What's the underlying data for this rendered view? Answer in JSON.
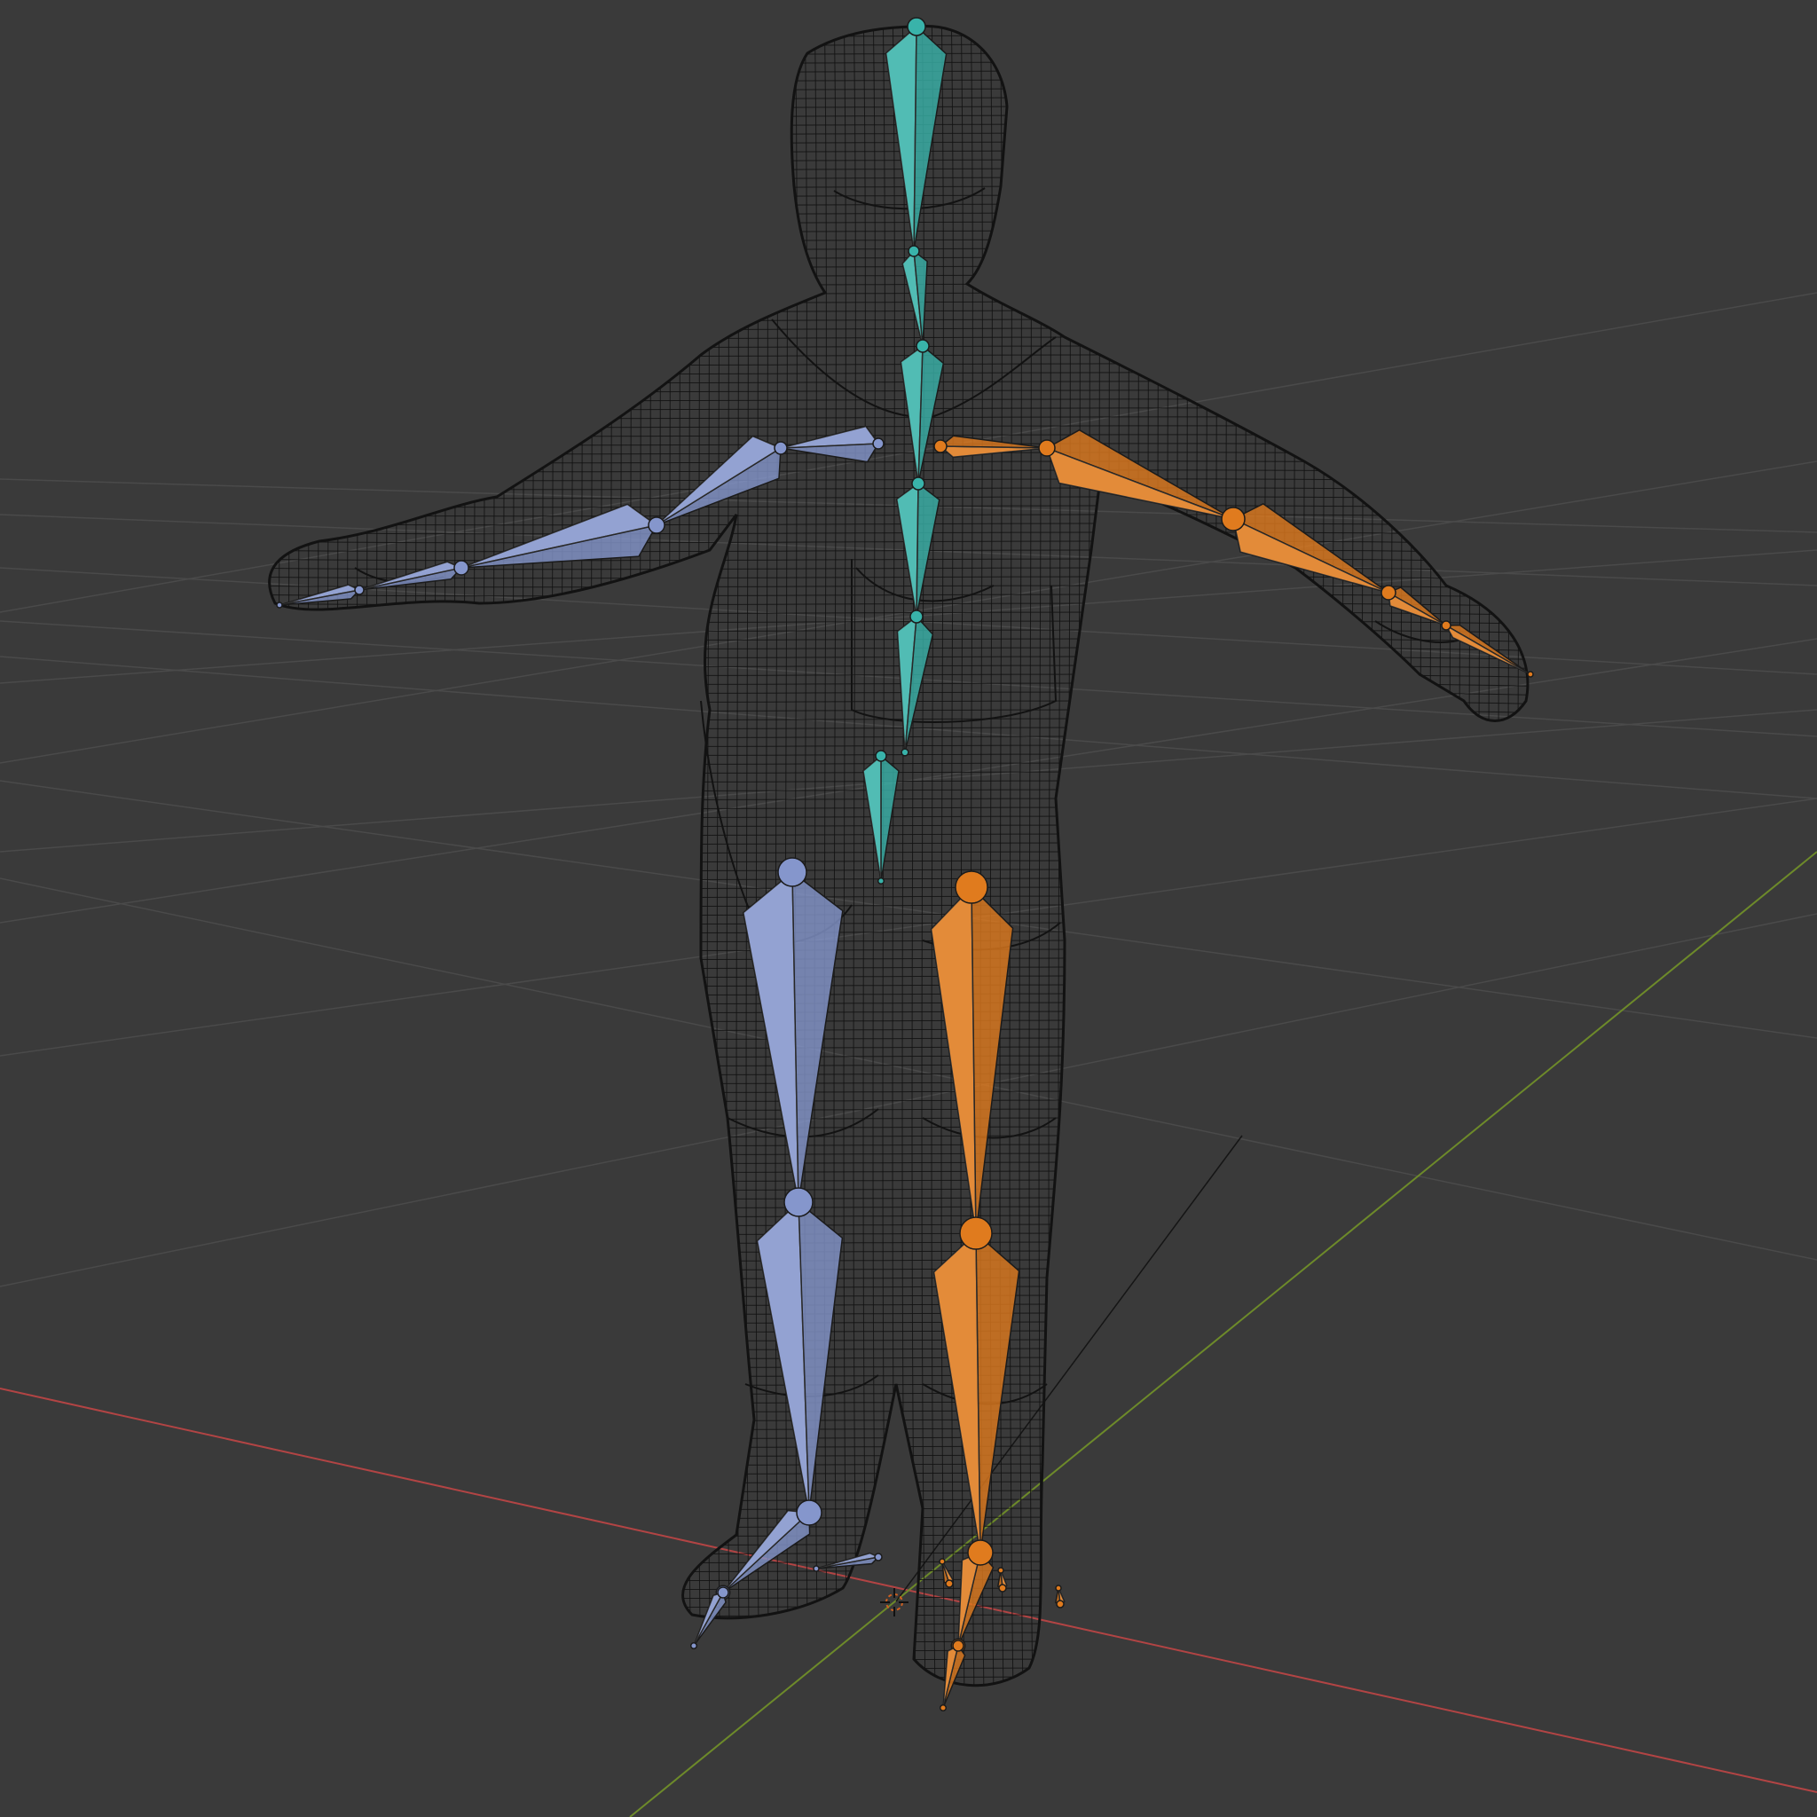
{
  "viewport": {
    "background_color": "#3a3a3a",
    "grid_color": "#4a4a4a",
    "x_axis_color": "#b24444",
    "y_axis_color": "#6d8a2a",
    "mesh_color": "#121212"
  },
  "armature": {
    "spine_color": "#39b3aa",
    "left_side_color": "#8596cc",
    "right_side_color": "#e07b1e",
    "bone_outline_color": "#1b1b1b"
  },
  "icons": {
    "origin_cursor": "3d-cursor-icon"
  }
}
